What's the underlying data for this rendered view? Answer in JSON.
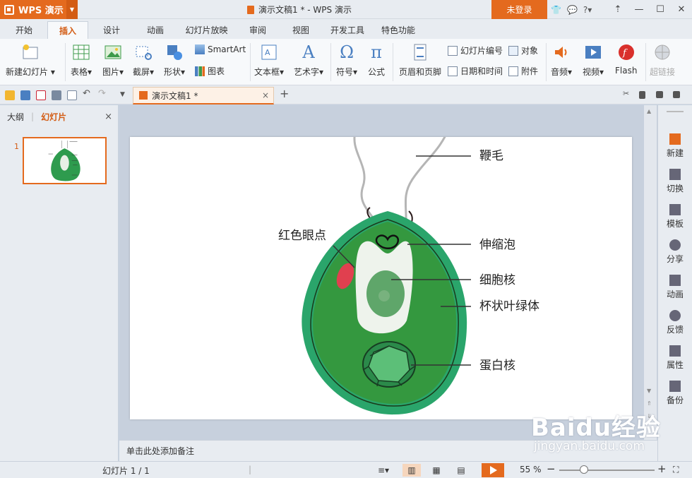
{
  "titlebar": {
    "app_name": "WPS 演示",
    "doc_title": "演示文稿1 * - WPS 演示",
    "login_label": "未登录",
    "help_label": "?"
  },
  "tabs": [
    "开始",
    "插入",
    "设计",
    "动画",
    "幻灯片放映",
    "审阅",
    "视图",
    "开发工具",
    "特色功能"
  ],
  "active_tab": "插入",
  "ribbon": {
    "new_slide": "新建幻灯片",
    "table": "表格",
    "picture": "图片",
    "screenshot": "截屏",
    "shape": "形状",
    "smartart": "SmartArt",
    "chart": "图表",
    "textbox": "文本框",
    "wordart": "艺术字",
    "symbol": "符号",
    "formula": "公式",
    "header_footer": "页眉和页脚",
    "slide_number": "幻灯片编号",
    "date_time": "日期和时间",
    "object": "对象",
    "attachment": "附件",
    "audio": "音频",
    "video": "视频",
    "flash": "Flash",
    "hyperlink": "超链接"
  },
  "document_tab": {
    "title": "演示文稿1 *",
    "close": "×",
    "new": "+"
  },
  "left_panel": {
    "tab_outline": "大纲",
    "tab_slides": "幻灯片",
    "close": "×",
    "slide_number": "1"
  },
  "slide": {
    "labels": {
      "flagellum": "鞭毛",
      "eyespot": "红色眼点",
      "contractile_vacuole": "伸缩泡",
      "nucleus": "细胞核",
      "chloroplast": "杯状叶绿体",
      "pyrenoid": "蛋白核"
    }
  },
  "notes_placeholder": "单击此处添加备注",
  "right_panel": [
    "新建",
    "切换",
    "模板",
    "分享",
    "动画",
    "反馈",
    "属性",
    "备份"
  ],
  "status": {
    "slide_counter": "幻灯片 1 / 1",
    "zoom": "55 %",
    "zoom_minus": "−",
    "zoom_plus": "+"
  },
  "watermark": {
    "big": "Baidu经验",
    "small": "jingyan.baidu.com"
  },
  "colors": {
    "accent": "#e46a1e",
    "cell_green": "#2e9b4e",
    "cell_border": "#2aa56b",
    "eyespot": "#e0404f"
  }
}
